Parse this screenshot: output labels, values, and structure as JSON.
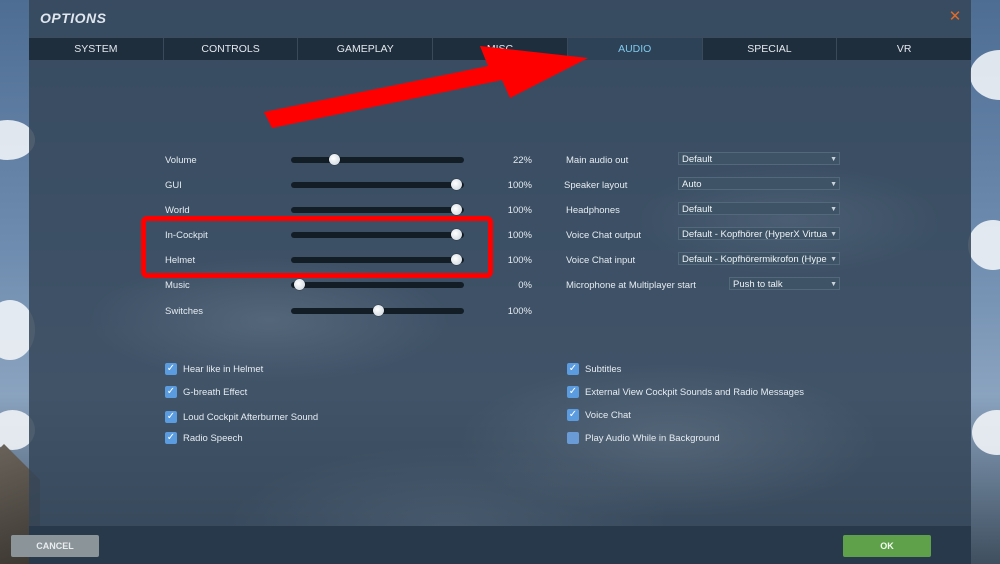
{
  "window": {
    "title": "OPTIONS"
  },
  "tabs": [
    {
      "label": "SYSTEM"
    },
    {
      "label": "CONTROLS"
    },
    {
      "label": "GAMEPLAY"
    },
    {
      "label": "MISC"
    },
    {
      "label": "AUDIO",
      "active": true
    },
    {
      "label": "SPECIAL"
    },
    {
      "label": "VR"
    }
  ],
  "sliders": [
    {
      "label": "Volume",
      "value": 22,
      "value_text": "22%"
    },
    {
      "label": "GUI",
      "value": 100,
      "value_text": "100%"
    },
    {
      "label": "World",
      "value": 100,
      "value_text": "100%"
    },
    {
      "label": "In-Cockpit",
      "value": 100,
      "value_text": "100%"
    },
    {
      "label": "Helmet",
      "value": 100,
      "value_text": "100%"
    },
    {
      "label": "Music",
      "value": 0,
      "value_text": "0%"
    },
    {
      "label": "Switches",
      "value": 50,
      "value_text": "100%"
    }
  ],
  "dropdowns": [
    {
      "label": "Main audio out",
      "value": "Default"
    },
    {
      "label": "Speaker layout",
      "value": "Auto"
    },
    {
      "label": "Headphones",
      "value": "Default"
    },
    {
      "label": "Voice Chat output",
      "value": "Default - Kopfhörer (HyperX Virtua"
    },
    {
      "label": "Voice Chat input",
      "value": "Default - Kopfhörermikrofon (Hype"
    },
    {
      "label": "Microphone at Multiplayer start",
      "value": "Push to talk"
    }
  ],
  "checkboxes_left": [
    {
      "label": "Hear like in Helmet",
      "checked": true
    },
    {
      "label": "G-breath Effect",
      "checked": true
    },
    {
      "label": "Loud Cockpit Afterburner Sound",
      "checked": true
    },
    {
      "label": "Radio Speech",
      "checked": true
    }
  ],
  "checkboxes_right": [
    {
      "label": "Subtitles",
      "checked": true
    },
    {
      "label": "External View Cockpit Sounds and Radio Messages",
      "checked": true
    },
    {
      "label": "Voice Chat",
      "checked": true
    },
    {
      "label": "Play Audio While in Background",
      "checked": false
    }
  ],
  "footer": {
    "cancel_label": "CANCEL",
    "ok_label": "OK"
  },
  "annotation": {
    "color": "#ff0000"
  },
  "icons": {
    "close": "close-icon",
    "check": "checkmark-icon",
    "dropdown": "chevron-down-icon"
  }
}
